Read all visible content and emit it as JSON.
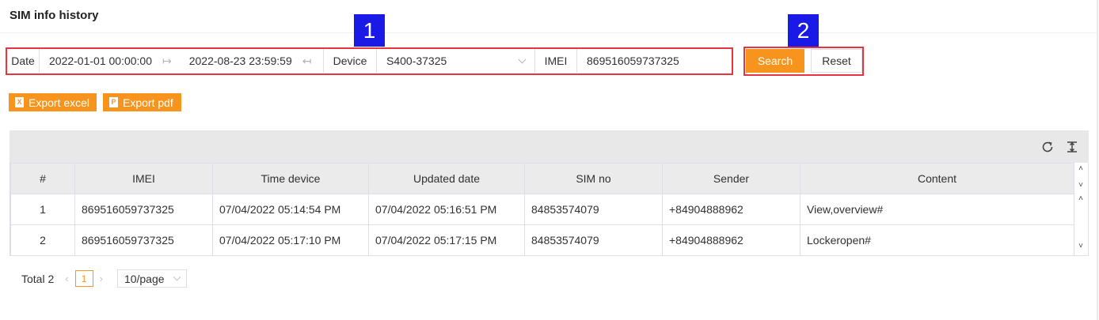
{
  "page": {
    "title": "SIM info history"
  },
  "filters": {
    "date_label": "Date",
    "date_from": "2022-01-01 00:00:00",
    "date_to": "2022-08-23 23:59:59",
    "device_label": "Device",
    "device_value": "S400-37325",
    "imei_label": "IMEI",
    "imei_value": "869516059737325"
  },
  "markers": {
    "one": "1",
    "two": "2"
  },
  "actions": {
    "search": "Search",
    "reset": "Reset",
    "export_excel": "Export excel",
    "export_pdf": "Export pdf"
  },
  "table": {
    "columns": [
      "#",
      "IMEI",
      "Time device",
      "Updated date",
      "SIM no",
      "Sender",
      "Content"
    ],
    "rows": [
      [
        "1",
        "869516059737325",
        "07/04/2022 05:14:54 PM",
        "07/04/2022 05:16:51 PM",
        "84853574079",
        "+84904888962",
        "View,overview#"
      ],
      [
        "2",
        "869516059737325",
        "07/04/2022 05:17:10 PM",
        "07/04/2022 05:17:15 PM",
        "84853574079",
        "+84904888962",
        "Lockeropen#"
      ]
    ]
  },
  "pagination": {
    "total": "Total 2",
    "current": "1",
    "page_size": "10/page"
  },
  "colors": {
    "accent": "#f7941d",
    "highlight": "#e8343e",
    "marker": "#1a1ae6"
  },
  "icons": [
    "range-arrow-icon",
    "chevron-down-icon",
    "excel-file-icon",
    "pdf-file-icon",
    "refresh-icon",
    "column-height-icon",
    "chevron-up-icon",
    "chevron-left-icon",
    "chevron-right-icon"
  ]
}
